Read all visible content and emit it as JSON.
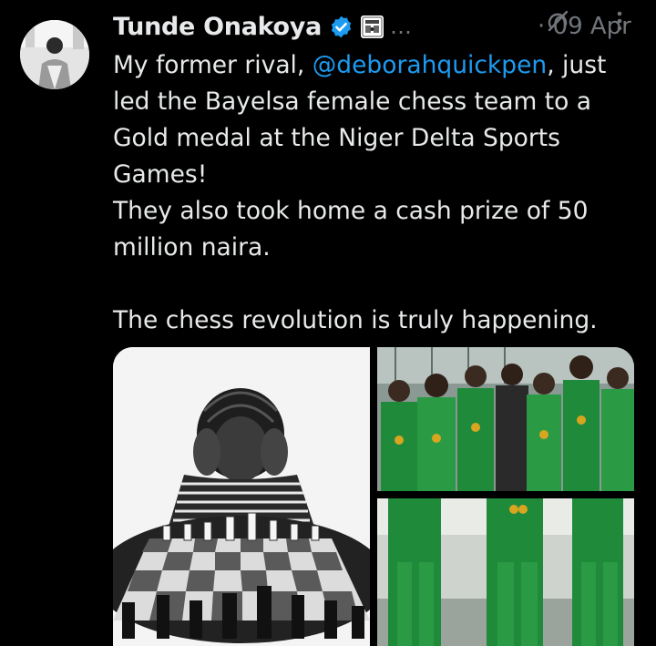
{
  "tweet": {
    "author_name": "Tunde Onakoya",
    "more_indicator": "…",
    "date": "· 09 Apr",
    "text_part1": "My former rival, ",
    "mention": "@deborahquickpen",
    "text_part2": ", just led the Bayelsa female chess team to a Gold medal at the Niger Delta Sports Games!\nThey also took home a cash prize of 50 million naira.\n\nThe chess revolution is truly happening."
  },
  "icons": {
    "verified": "verified-badge-icon",
    "affiliation": "affiliation-badge-icon",
    "grok": "grok-icon",
    "more": "more-options-icon"
  },
  "colors": {
    "background": "#000000",
    "text": "#e7e9ea",
    "secondary": "#71767b",
    "link": "#1d9bf0"
  }
}
